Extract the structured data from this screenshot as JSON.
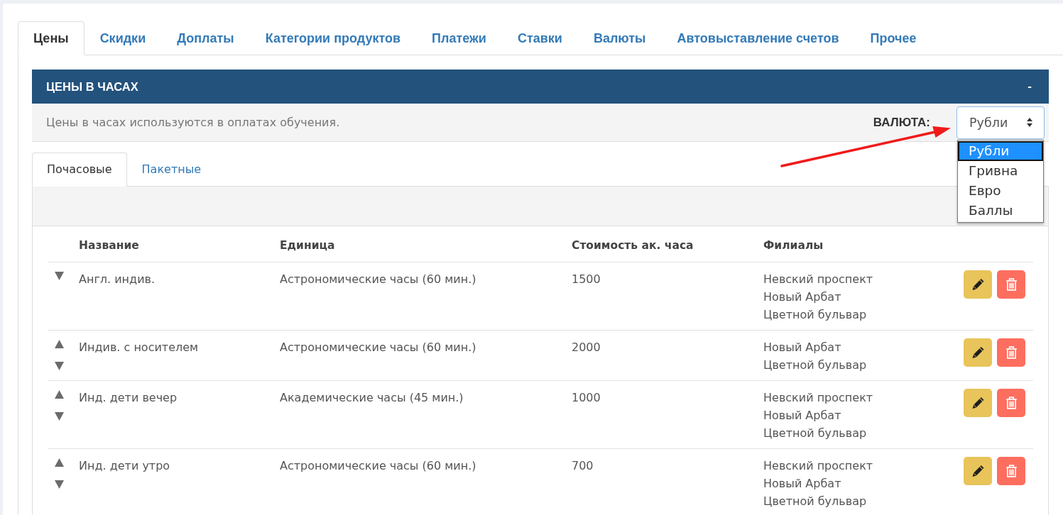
{
  "main_tabs": [
    {
      "label": "Цены",
      "selected": true
    },
    {
      "label": "Скидки",
      "selected": false
    },
    {
      "label": "Доплаты",
      "selected": false
    },
    {
      "label": "Категории продуктов",
      "selected": false
    },
    {
      "label": "Платежи",
      "selected": false
    },
    {
      "label": "Ставки",
      "selected": false
    },
    {
      "label": "Валюты",
      "selected": false
    },
    {
      "label": "Автовыставление счетов",
      "selected": false
    },
    {
      "label": "Прочее",
      "selected": false
    }
  ],
  "panel": {
    "title": "ЦЕНЫ В ЧАСАХ",
    "collapse_symbol": "-",
    "description": "Цены в часах используются в оплатах обучения.",
    "currency": {
      "label": "ВАЛЮТА:",
      "value": "Рубли",
      "expanded": true,
      "options": [
        {
          "label": "Рубли",
          "selected": true
        },
        {
          "label": "Гривна",
          "selected": false
        },
        {
          "label": "Евро",
          "selected": false
        },
        {
          "label": "Баллы",
          "selected": false
        }
      ]
    }
  },
  "sub_tabs": [
    {
      "label": "Почасовые",
      "selected": true
    },
    {
      "label": "Пакетные",
      "selected": false
    }
  ],
  "table": {
    "columns": [
      "Название",
      "Единица",
      "Стоимость ак. часа",
      "Филиалы"
    ],
    "rows": [
      {
        "name": "Англ. индив.",
        "unit": "Астрономические часы (60 мин.)",
        "cost": "1500",
        "branches": [
          "Невский проспект",
          "Новый Арбат",
          "Цветной бульвар"
        ],
        "can_move_up": false,
        "can_move_down": true
      },
      {
        "name": "Индив. с носителем",
        "unit": "Астрономические часы (60 мин.)",
        "cost": "2000",
        "branches": [
          "Новый Арбат",
          "Цветной бульвар"
        ],
        "can_move_up": true,
        "can_move_down": true
      },
      {
        "name": "Инд. дети вечер",
        "unit": "Академические часы (45 мин.)",
        "cost": "1000",
        "branches": [
          "Невский проспект",
          "Новый Арбат",
          "Цветной бульвар"
        ],
        "can_move_up": true,
        "can_move_down": true
      },
      {
        "name": "Инд. дети утро",
        "unit": "Астрономические часы (60 мин.)",
        "cost": "700",
        "branches": [
          "Невский проспект",
          "Новый Арбат",
          "Цветной бульвар"
        ],
        "can_move_up": true,
        "can_move_down": true
      }
    ]
  }
}
